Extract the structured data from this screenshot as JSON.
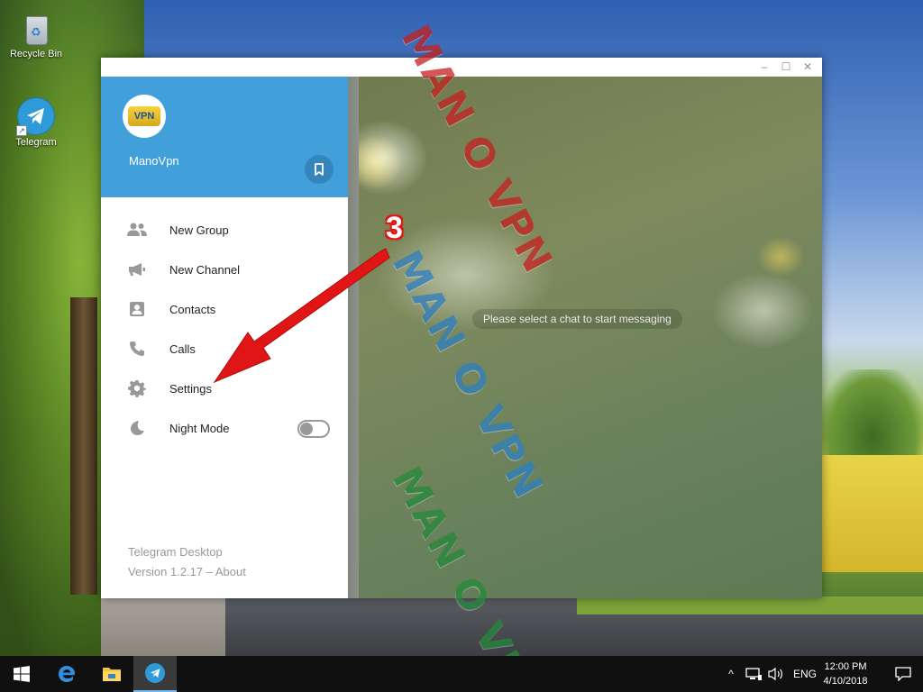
{
  "desktop": {
    "icons": [
      {
        "label": "Recycle Bin",
        "icon": "recycle-bin-icon"
      },
      {
        "label": "Telegram",
        "icon": "telegram-icon"
      }
    ]
  },
  "window": {
    "controls": {
      "minimize": "–",
      "maximize": "☐",
      "close": "✕"
    }
  },
  "sidebar": {
    "user_name": "ManoVpn",
    "avatar_logo": "VPN",
    "items": [
      {
        "label": "New Group",
        "icon": "group-icon"
      },
      {
        "label": "New Channel",
        "icon": "megaphone-icon"
      },
      {
        "label": "Contacts",
        "icon": "contact-icon"
      },
      {
        "label": "Calls",
        "icon": "phone-icon"
      },
      {
        "label": "Settings",
        "icon": "gear-icon"
      },
      {
        "label": "Night Mode",
        "icon": "moon-icon",
        "toggle": false
      }
    ],
    "footer_title": "Telegram Desktop",
    "footer_version": "Version 1.2.17 – ",
    "footer_about": "About"
  },
  "chat": {
    "empty_message": "Please select a chat to start messaging"
  },
  "annotation": {
    "step": "3"
  },
  "watermark": {
    "text": "MAN O VPN"
  },
  "taskbar": {
    "language": "ENG",
    "time": "12:00 PM",
    "date": "4/10/2018"
  },
  "colors": {
    "accent": "#419fd9",
    "annotation": "#e01515"
  }
}
